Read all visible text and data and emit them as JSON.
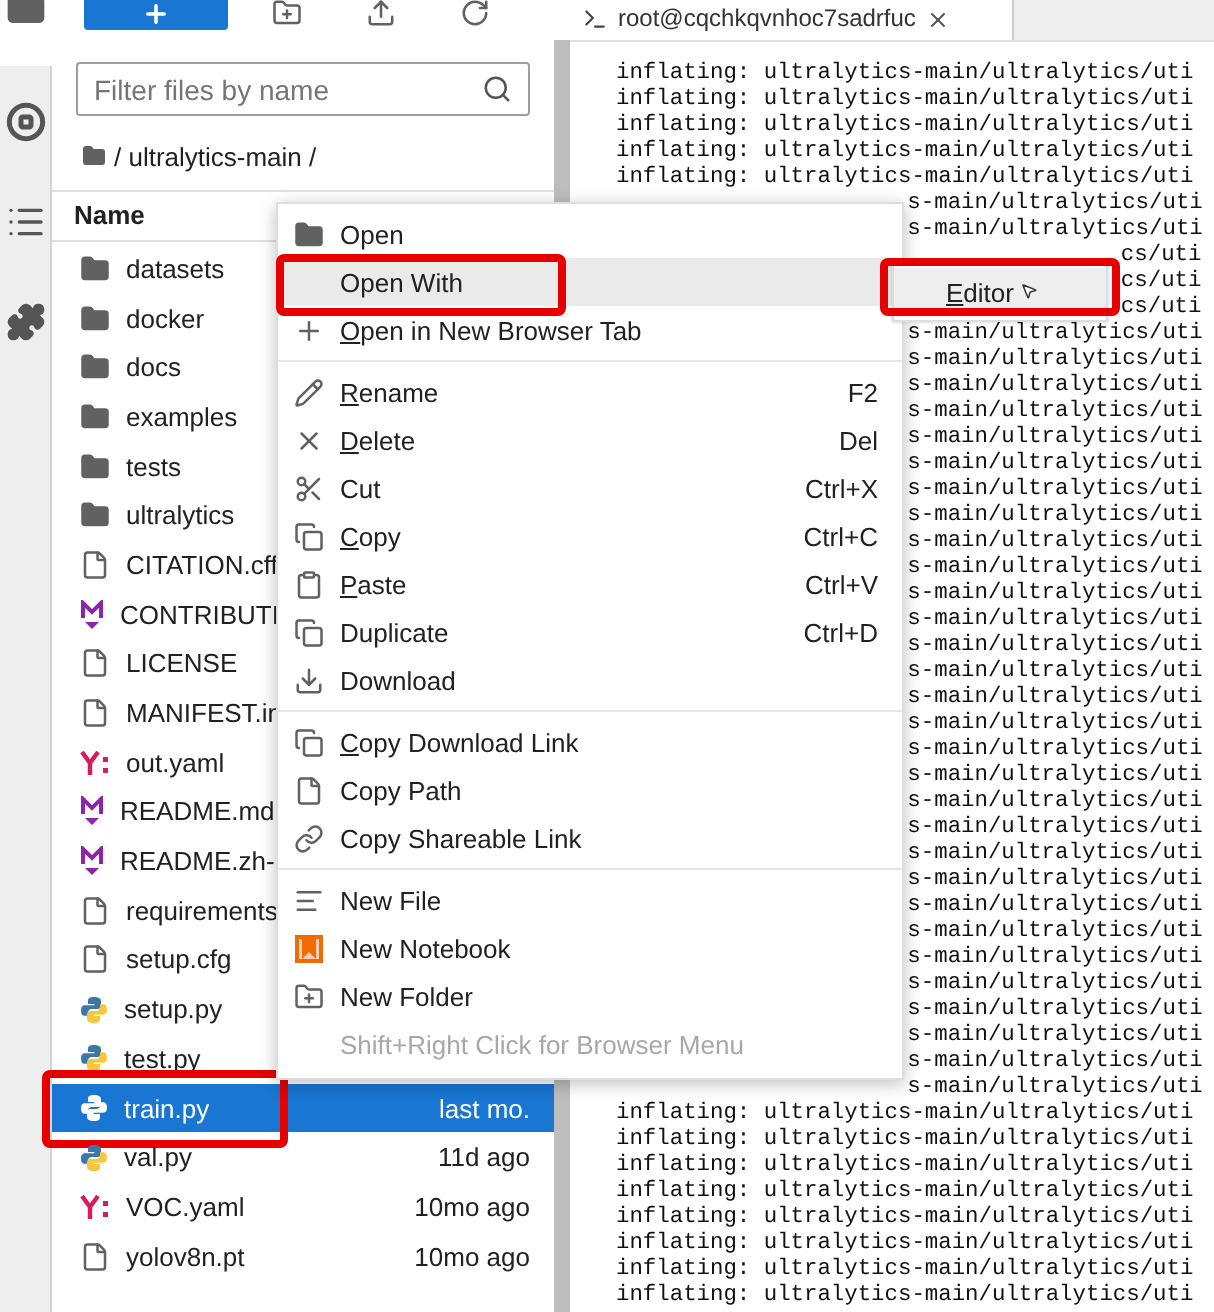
{
  "filter": {
    "placeholder": "Filter files by name"
  },
  "breadcrumb": "/ ultralytics-main /",
  "columns": [
    {
      "label": "Name"
    }
  ],
  "files": [
    {
      "name": "datasets",
      "kind": "folder",
      "selected": false
    },
    {
      "name": "docker",
      "kind": "folder",
      "selected": false
    },
    {
      "name": "docs",
      "kind": "folder",
      "selected": false
    },
    {
      "name": "examples",
      "kind": "folder",
      "selected": false
    },
    {
      "name": "tests",
      "kind": "folder",
      "selected": false
    },
    {
      "name": "ultralytics",
      "kind": "folder",
      "selected": false
    },
    {
      "name": "CITATION.cff",
      "kind": "file",
      "selected": false
    },
    {
      "name": "CONTRIBUTI",
      "kind": "markdown",
      "selected": false
    },
    {
      "name": "LICENSE",
      "kind": "file",
      "selected": false
    },
    {
      "name": "MANIFEST.in",
      "kind": "file",
      "selected": false
    },
    {
      "name": "out.yaml",
      "kind": "yaml",
      "selected": false
    },
    {
      "name": "README.md",
      "kind": "markdown",
      "selected": false
    },
    {
      "name": "README.zh-",
      "kind": "markdown",
      "selected": false
    },
    {
      "name": "requirements",
      "kind": "file",
      "selected": false
    },
    {
      "name": "setup.cfg",
      "kind": "file",
      "selected": false
    },
    {
      "name": "setup.py",
      "kind": "python",
      "selected": false
    },
    {
      "name": "test.py",
      "kind": "python",
      "selected": false
    },
    {
      "name": "train.py",
      "kind": "python",
      "selected": true,
      "highlighted": true,
      "modified": "last mo."
    },
    {
      "name": "val.py",
      "kind": "python",
      "selected": false,
      "modified": "11d ago"
    },
    {
      "name": "VOC.yaml",
      "kind": "yaml",
      "selected": false,
      "modified": "10mo ago"
    },
    {
      "name": "yolov8n.pt",
      "kind": "file",
      "selected": false,
      "modified": "10mo ago"
    }
  ],
  "terminal": {
    "tab_title": "root@cqchkqvnhoc7sadrfuc",
    "lines": [
      {
        "kind": "full",
        "text": "inflating: ultralytics-main/ultralytics/uti"
      },
      {
        "kind": "full",
        "text": "inflating: ultralytics-main/ultralytics/uti"
      },
      {
        "kind": "full",
        "text": "inflating: ultralytics-main/ultralytics/uti"
      },
      {
        "kind": "full",
        "text": "inflating: ultralytics-main/ultralytics/uti"
      },
      {
        "kind": "full",
        "text": "inflating: ultralytics-main/ultralytics/uti"
      },
      {
        "kind": "behind_menu",
        "text": "s-main/ultralytics/uti"
      },
      {
        "kind": "behind_menu",
        "text": "s-main/ultralytics/uti"
      },
      {
        "kind": "behind_submenu",
        "text": "cs/uti"
      },
      {
        "kind": "behind_submenu",
        "text": "cs/uti"
      },
      {
        "kind": "behind_submenu",
        "text": "cs/uti"
      },
      {
        "kind": "behind_menu",
        "text": "s-main/ultralytics/uti"
      },
      {
        "kind": "behind_menu",
        "text": "s-main/ultralytics/uti"
      },
      {
        "kind": "behind_menu",
        "text": "s-main/ultralytics/uti"
      },
      {
        "kind": "behind_menu",
        "text": "s-main/ultralytics/uti"
      },
      {
        "kind": "behind_menu",
        "text": "s-main/ultralytics/uti"
      },
      {
        "kind": "behind_menu",
        "text": "s-main/ultralytics/uti"
      },
      {
        "kind": "behind_menu",
        "text": "s-main/ultralytics/uti"
      },
      {
        "kind": "behind_menu",
        "text": "s-main/ultralytics/uti"
      },
      {
        "kind": "behind_menu",
        "text": "s-main/ultralytics/uti"
      },
      {
        "kind": "behind_menu",
        "text": "s-main/ultralytics/uti"
      },
      {
        "kind": "behind_menu",
        "text": "s-main/ultralytics/uti"
      },
      {
        "kind": "behind_menu",
        "text": "s-main/ultralytics/uti"
      },
      {
        "kind": "behind_menu",
        "text": "s-main/ultralytics/uti"
      },
      {
        "kind": "behind_menu",
        "text": "s-main/ultralytics/uti"
      },
      {
        "kind": "behind_menu",
        "text": "s-main/ultralytics/uti"
      },
      {
        "kind": "behind_menu",
        "text": "s-main/ultralytics/uti"
      },
      {
        "kind": "behind_menu",
        "text": "s-main/ultralytics/uti"
      },
      {
        "kind": "behind_menu",
        "text": "s-main/ultralytics/uti"
      },
      {
        "kind": "behind_menu",
        "text": "s-main/ultralytics/uti"
      },
      {
        "kind": "behind_menu",
        "text": "s-main/ultralytics/uti"
      },
      {
        "kind": "behind_menu",
        "text": "s-main/ultralytics/uti"
      },
      {
        "kind": "behind_menu",
        "text": "s-main/ultralytics/uti"
      },
      {
        "kind": "behind_menu",
        "text": "s-main/ultralytics/uti"
      },
      {
        "kind": "behind_menu",
        "text": "s-main/ultralytics/uti"
      },
      {
        "kind": "behind_menu",
        "text": "s-main/ultralytics/uti"
      },
      {
        "kind": "behind_menu",
        "text": "s-main/ultralytics/uti"
      },
      {
        "kind": "behind_menu",
        "text": "s-main/ultralytics/uti"
      },
      {
        "kind": "behind_menu",
        "text": "s-main/ultralytics/uti"
      },
      {
        "kind": "behind_menu",
        "text": "s-main/ultralytics/uti"
      },
      {
        "kind": "behind_menu",
        "text": "s-main/ultralytics/uti"
      },
      {
        "kind": "full",
        "text": "inflating: ultralytics-main/ultralytics/uti"
      },
      {
        "kind": "full",
        "text": "inflating: ultralytics-main/ultralytics/uti"
      },
      {
        "kind": "full",
        "text": "inflating: ultralytics-main/ultralytics/uti"
      },
      {
        "kind": "full",
        "text": "inflating: ultralytics-main/ultralytics/uti"
      },
      {
        "kind": "full",
        "text": "inflating: ultralytics-main/ultralytics/uti"
      },
      {
        "kind": "full",
        "text": "inflating: ultralytics-main/ultralytics/uti"
      },
      {
        "kind": "full",
        "text": "inflating: ultralytics-main/ultralytics/uti"
      },
      {
        "kind": "full",
        "text": "inflating: ultralytics-main/ultralytics/uti"
      }
    ]
  },
  "context_menu": {
    "groups": [
      [
        {
          "label": "Open",
          "kind": "folder",
          "hovered": false
        },
        {
          "label": "Open With",
          "kind": "none",
          "hovered": true,
          "highlighted": true
        },
        {
          "label": "Open in New Browser Tab",
          "kind": "plus",
          "hovered": false,
          "mnemonic": true
        }
      ],
      [
        {
          "label": "Rename",
          "kind": "pencil",
          "shortcut": "F2",
          "hovered": false,
          "mnemonic": true
        },
        {
          "label": "Delete",
          "kind": "x",
          "shortcut": "Del",
          "hovered": false,
          "mnemonic": true
        },
        {
          "label": "Cut",
          "kind": "scissors",
          "shortcut": "Ctrl+X",
          "hovered": false
        },
        {
          "label": "Copy",
          "kind": "copy",
          "shortcut": "Ctrl+C",
          "hovered": false,
          "mnemonic": true
        },
        {
          "label": "Paste",
          "kind": "paste",
          "shortcut": "Ctrl+V",
          "hovered": false,
          "mnemonic": true
        },
        {
          "label": "Duplicate",
          "kind": "copy",
          "shortcut": "Ctrl+D",
          "hovered": false
        },
        {
          "label": "Download",
          "kind": "download",
          "hovered": false
        }
      ],
      [
        {
          "label": "Copy Download Link",
          "kind": "copy",
          "hovered": false,
          "mnemonic": true
        },
        {
          "label": "Copy Path",
          "kind": "file",
          "hovered": false
        },
        {
          "label": "Copy Shareable Link",
          "kind": "link",
          "hovered": false
        }
      ],
      [
        {
          "label": "New File",
          "kind": "lines",
          "hovered": false
        },
        {
          "label": "New Notebook",
          "kind": "notebook",
          "hovered": false
        },
        {
          "label": "New Folder",
          "kind": "folder_plus",
          "hovered": false
        },
        {
          "label": "Shift+Right Click for Browser Menu",
          "kind": "none",
          "hovered": false,
          "disabled": true
        }
      ]
    ]
  },
  "submenu": {
    "items": [
      {
        "label": "Editor",
        "mnemonic": true,
        "highlighted": true
      }
    ]
  }
}
